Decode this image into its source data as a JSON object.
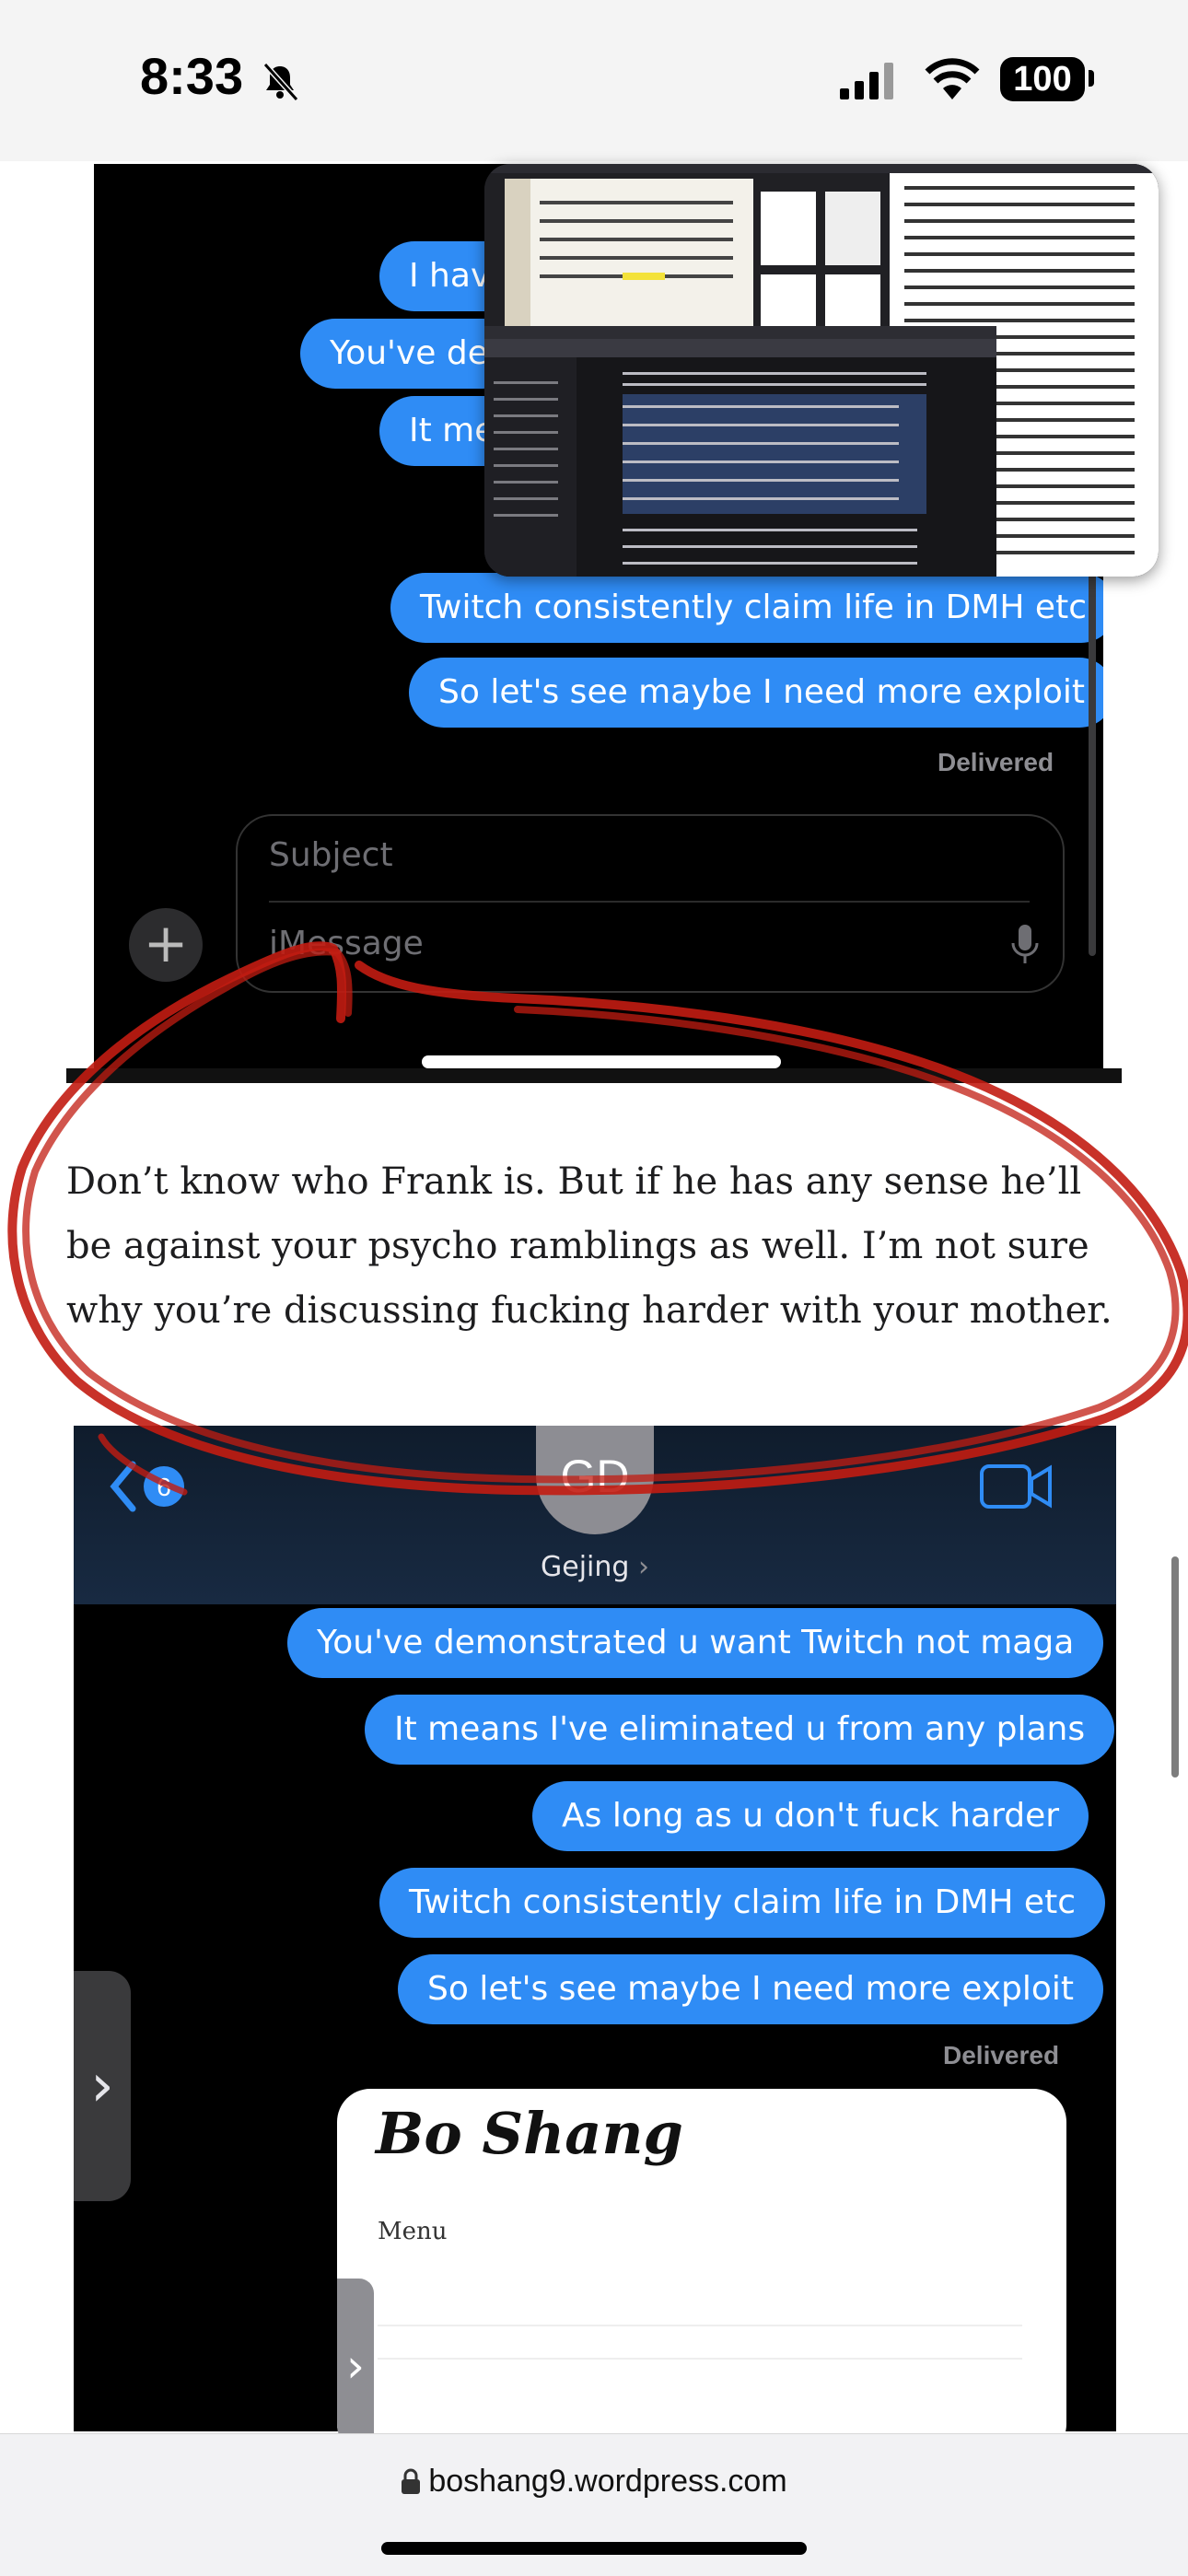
{
  "status_bar": {
    "time": "8:33",
    "battery": "100"
  },
  "screenshot_top": {
    "bubbles": [
      "I hav",
      "You've de",
      "It me",
      "Twitch consistently claim life in DMH etc",
      "So let's see maybe I need more exploit"
    ],
    "delivered": "Delivered",
    "subject_placeholder": "Subject",
    "message_placeholder": "iMessage"
  },
  "article": {
    "paragraph": "Don’t know who Frank is. But if he has any sense he’ll be against your psycho ramblings as well. I’m not sure why you’re discussing fucking harder with your mother."
  },
  "screenshot_bottom": {
    "avatar_initials": "GD",
    "contact_name": "Gejing",
    "back_badge": "6",
    "bubbles": [
      "You've demonstrated u want Twitch not maga",
      "It means I've eliminated u from any plans",
      "As long as u don't fuck harder",
      "Twitch consistently claim life in DMH etc",
      "So let's see maybe I need more exploit"
    ],
    "delivered": "Delivered",
    "card": {
      "title": "Bo Shang",
      "menu": "Menu",
      "tab_glyph": "›"
    },
    "side_tab_glyph": "›"
  },
  "browser": {
    "url": "boshang9.wordpress.com"
  },
  "colors": {
    "bubble_blue": "#2f8cf5",
    "annotation_red": "#c21c12"
  }
}
